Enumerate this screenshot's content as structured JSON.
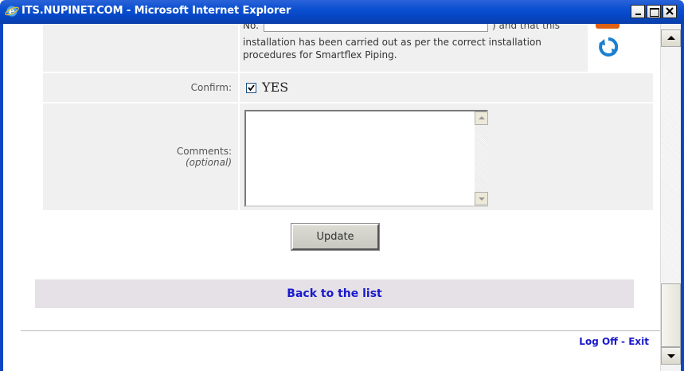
{
  "window": {
    "title": "ITS.NUPINET.COM - Microsoft Internet Explorer"
  },
  "form": {
    "installation": {
      "no_label": "No.",
      "no_value": "",
      "tail_text": ") and that this",
      "statement": "installation has been carried out as per the correct installation procedures for Smartflex Piping."
    },
    "confirm": {
      "label": "Confirm:",
      "checked": true,
      "value_label": "YES"
    },
    "comments": {
      "label": "Comments:",
      "optional_label": "(optional)",
      "value": ""
    },
    "update_button": "Update"
  },
  "nav": {
    "back_link": "Back to the list",
    "logoff_link": "Log Off - Exit"
  },
  "colors": {
    "link": "#1a1acc",
    "cell_background": "#f0f0f0",
    "back_bar": "#e6e1e6",
    "titlebar": "#0a4fd1",
    "refresh_icon": "#1a7fd0"
  },
  "icons": {
    "window_icon": "internet-explorer-icon",
    "refresh": "refresh-icon",
    "minimize": "minimize-icon",
    "maximize": "maximize-icon",
    "close": "close-icon"
  }
}
